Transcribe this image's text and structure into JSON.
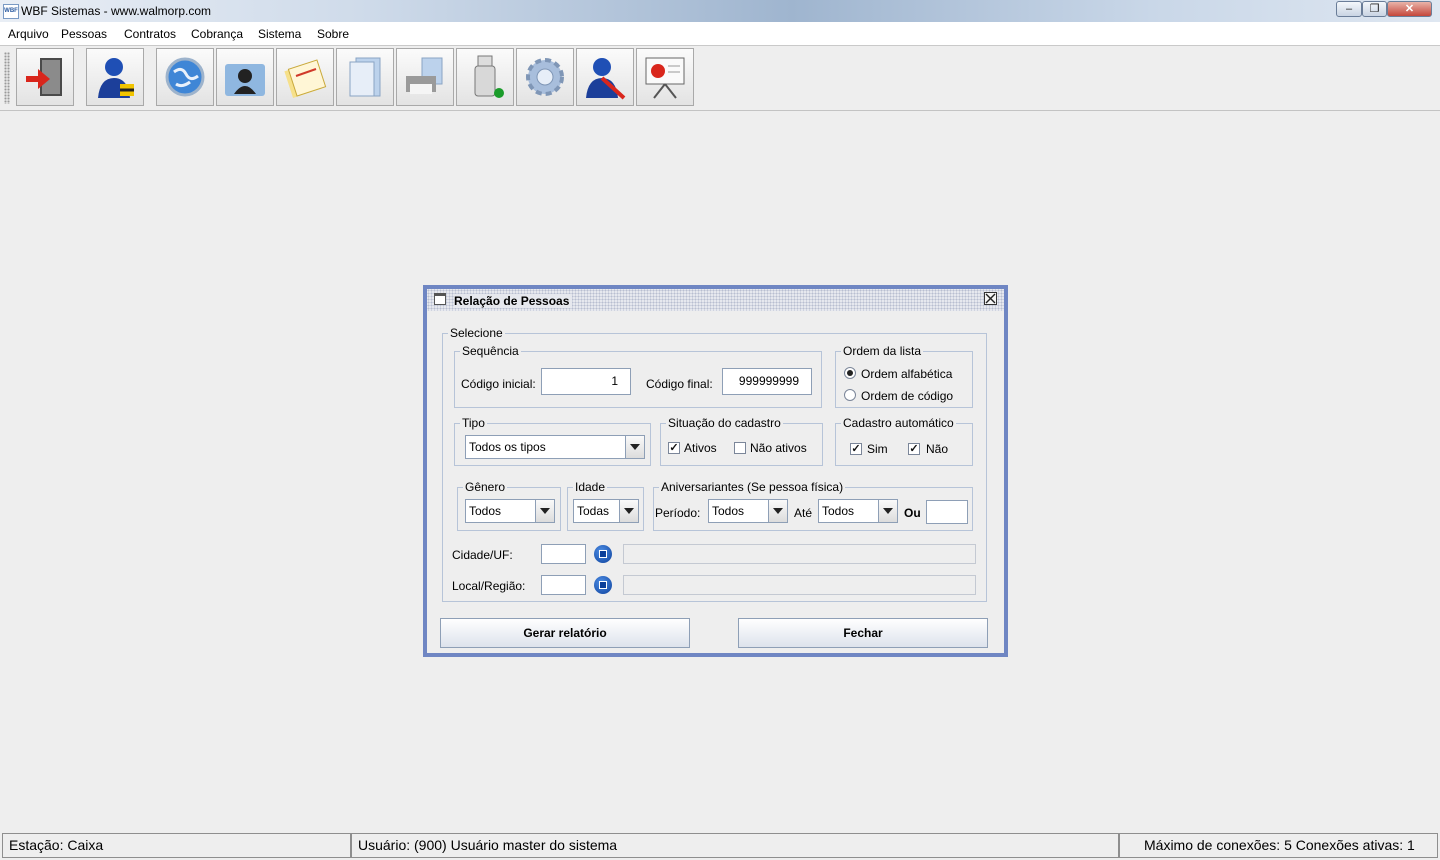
{
  "window": {
    "app_icon_text": "WBF",
    "title": "WBF Sistemas - www.walmorp.com"
  },
  "menu": {
    "items": [
      {
        "label": "Arquivo"
      },
      {
        "label": "Pessoas"
      },
      {
        "label": "Contratos"
      },
      {
        "label": "Cobrança"
      },
      {
        "label": "Sistema"
      },
      {
        "label": "Sobre"
      }
    ]
  },
  "toolbar": {
    "buttons": [
      "exit-door-icon",
      "user-lock-icon",
      "globe-icon",
      "contacts-folder-icon",
      "notes-icon",
      "documents-icon",
      "printer-icon",
      "usb-drive-icon",
      "gear-icon",
      "user-tools-icon",
      "presentation-board-icon"
    ]
  },
  "dialog": {
    "title": "Relação de Pessoas",
    "selecione_label": "Selecione",
    "sequencia": {
      "legend": "Sequência",
      "codigo_inicial_label": "Código inicial:",
      "codigo_inicial_value": "1",
      "codigo_final_label": "Código final:",
      "codigo_final_value": "999999999"
    },
    "ordem": {
      "legend": "Ordem da lista",
      "options": [
        {
          "label": "Ordem alfabética",
          "selected": true
        },
        {
          "label": "Ordem de código",
          "selected": false
        }
      ]
    },
    "tipo": {
      "legend": "Tipo",
      "selected": "Todos os tipos"
    },
    "situacao": {
      "legend": "Situação do cadastro",
      "ativos_label": "Ativos",
      "ativos_checked": true,
      "nao_ativos_label": "Não ativos",
      "nao_ativos_checked": false
    },
    "cadastro_auto": {
      "legend": "Cadastro automático",
      "sim_label": "Sim",
      "sim_checked": true,
      "nao_label": "Não",
      "nao_checked": true
    },
    "genero": {
      "legend": "Gênero",
      "selected": "Todos"
    },
    "idade": {
      "legend": "Idade",
      "selected": "Todas"
    },
    "aniversariantes": {
      "legend": "Aniversariantes (Se pessoa física)",
      "periodo_label": "Período:",
      "periodo_selected": "Todos",
      "ate_label": "Até",
      "ate_selected": "Todos",
      "ou_label": "Ou",
      "ou_value": ""
    },
    "cidade_label": "Cidade/UF:",
    "cidade_value": "",
    "cidade_desc": "",
    "local_label": "Local/Região:",
    "local_value": "",
    "local_desc": "",
    "gerar_button": "Gerar relatório",
    "fechar_button": "Fechar"
  },
  "status": {
    "estacao": "Estação: Caixa",
    "usuario": "Usuário: (900) Usuário master do sistema",
    "conexoes": "Máximo de conexões: 5 Conexões ativas: 1"
  }
}
